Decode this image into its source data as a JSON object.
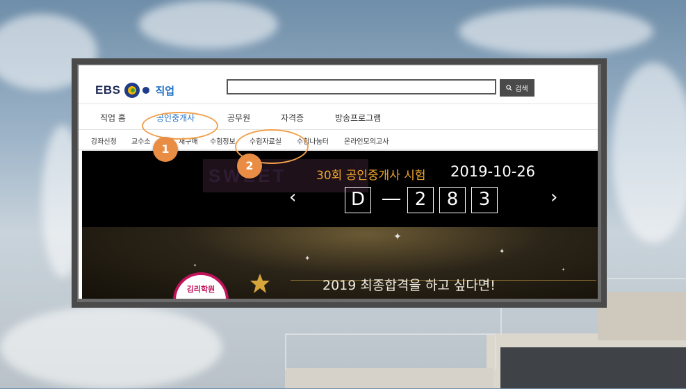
{
  "header": {
    "logo_text": "EBS",
    "logo_job": "직업",
    "search_placeholder": "",
    "search_button_label": "검색"
  },
  "gnb": {
    "items": [
      {
        "label": "직업 홈"
      },
      {
        "label": "공인중개사"
      },
      {
        "label": "공무원"
      },
      {
        "label": "자격증"
      },
      {
        "label": "방송프로그램"
      }
    ]
  },
  "lnb": {
    "items": [
      {
        "label": "강좌신청"
      },
      {
        "label": "교수소"
      },
      {
        "label": "재구매"
      },
      {
        "label": "수험정보"
      },
      {
        "label": "수험자료실"
      },
      {
        "label": "수험나눔터"
      },
      {
        "label": "온라인모의고사"
      }
    ]
  },
  "countdown": {
    "title": "30회 공인중개사 시험",
    "date": "2019-10-26",
    "prefix": "D",
    "dash": "—",
    "digits": [
      "2",
      "8",
      "3"
    ],
    "prev_arrow": "‹",
    "next_arrow": "›",
    "watermark": "SWEET"
  },
  "promo": {
    "headline": "2019 최종합격을 하고 싶다면!",
    "badge_text": "김리학원"
  },
  "annotations": {
    "marker_1": "1",
    "marker_2": "2"
  },
  "colors": {
    "accent_blue": "#1f6fc4",
    "annotation_orange": "#e98d44",
    "exam_title_orange": "#f0a52d"
  }
}
